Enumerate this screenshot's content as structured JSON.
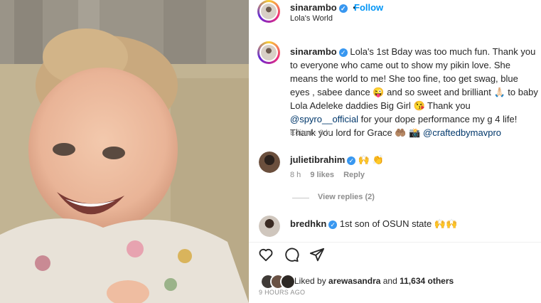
{
  "post": {
    "username": "sinarambo",
    "follow_label": "Follow",
    "location": "Lola's World",
    "separator": "•"
  },
  "caption": {
    "username": "sinarambo",
    "text_1": " Lola's 1st Bday was too much fun. Thank you to everyone who came out to show my pikin love. She means the world to me! She too fine, too get swag, blue eyes , sabee dance 😜 and so sweet and brilliant 🙏🏻 to baby Lola Adeleke daddies Big Girl 😘 Thank you ",
    "mention_1": "@spyro__official",
    "text_2": " for your dope performance my g 4 life! Thank you lord for Grace 🤲🏽 📸 ",
    "mention_2": "@craftedbymavpro",
    "edited": "Edited · 8 h"
  },
  "comments": [
    {
      "username": "julietibrahim",
      "text": "🙌 👏",
      "time": "8 h",
      "likes": "9 likes",
      "reply": "Reply"
    },
    {
      "username": "bredhkn",
      "text": "1st son of OSUN state 🙌🙌"
    }
  ],
  "view_replies": "View replies (2)",
  "actions": {
    "like_icon": "heart-icon",
    "comment_icon": "comment-icon",
    "share_icon": "paper-plane-icon"
  },
  "likes": {
    "prefix": "Liked by ",
    "user": "arewasandra",
    "middle": " and ",
    "count": "11,634 others"
  },
  "timestamp": "9 HOURS AGO",
  "colors": {
    "accent": "#0095f6",
    "verified": "#3897f0",
    "muted": "#8e8e8e"
  }
}
